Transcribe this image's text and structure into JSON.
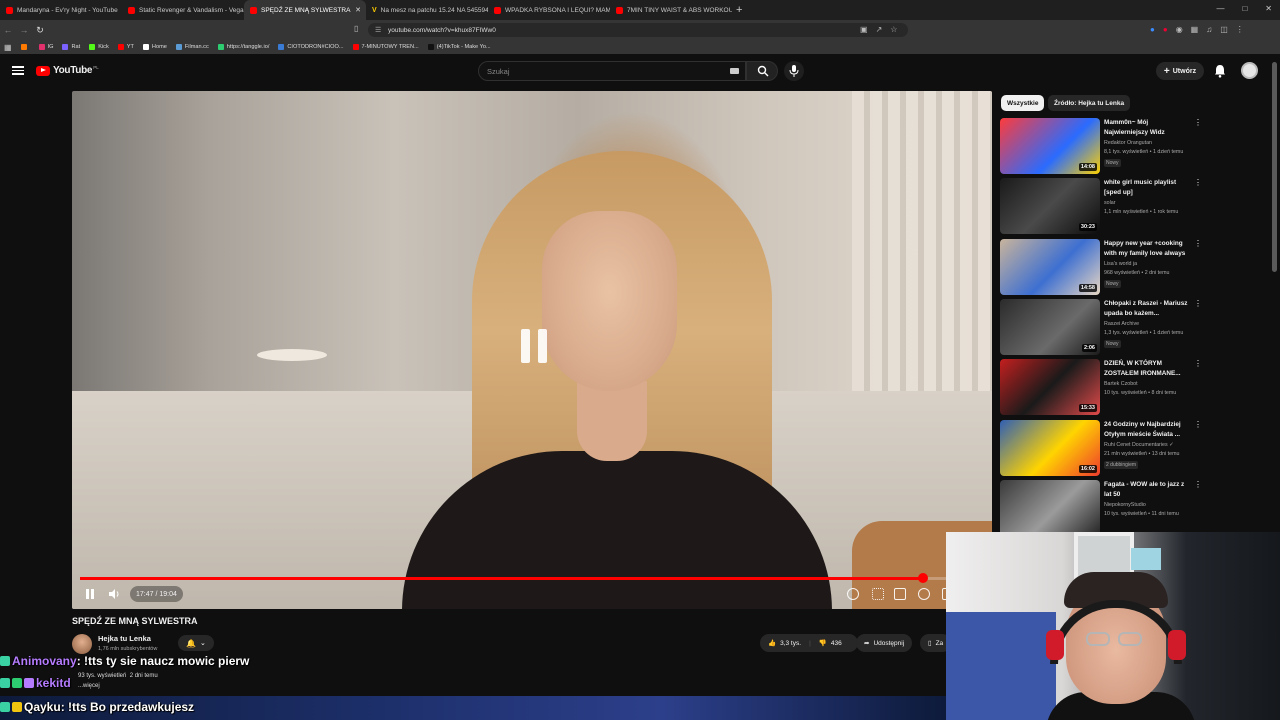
{
  "browser": {
    "tabs": [
      {
        "label": "Mandaryna - Ev'ry Night - YouTube",
        "fav": "yt"
      },
      {
        "label": "Static Revenger & Vandalism - Vega...",
        "fav": "yt"
      },
      {
        "label": "SPĘDŹ ZE MNĄ SYLWESTRA",
        "fav": "yt",
        "active": true
      },
      {
        "label": "Na mesz na patchu 15.24 NA 545594",
        "fav": "v"
      },
      {
        "label": "WPADKA RYBSONA I LEQUI? MAMM...",
        "fav": "yt"
      },
      {
        "label": "7MIN TINY WAIST & ABS WORKOUT...",
        "fav": "yt"
      }
    ],
    "new_tab": "+",
    "url": "youtube.com/watch?v=khux87FIWw0",
    "bookmarks": [
      {
        "label": "",
        "color": "#ff7a00"
      },
      {
        "label": "IG",
        "color": "#e1306c"
      },
      {
        "label": "Rat",
        "color": "#7b61ff"
      },
      {
        "label": "Kick",
        "color": "#53fc18"
      },
      {
        "label": "YT",
        "color": "#ff0000"
      },
      {
        "label": "Home",
        "color": "#ffffff"
      },
      {
        "label": "Filman.cc",
        "color": "#5a9bd5"
      },
      {
        "label": "https://tanggle.io/",
        "color": "#2ecc71"
      },
      {
        "label": "CIOTODRON#CIOO...",
        "color": "#3a7bd5"
      },
      {
        "label": "7-MINUTOWY TREN...",
        "color": "#ff0000"
      },
      {
        "label": "(4)TikTok - Make Yo...",
        "color": "#111111"
      }
    ]
  },
  "masthead": {
    "logo_text": "YouTube",
    "country_code": "PL",
    "search_placeholder": "Szukaj",
    "create_label": "Utwórz"
  },
  "player": {
    "time": "17:47 / 19:04",
    "progress": 0.932
  },
  "video": {
    "title": "SPĘDŹ ZE MNĄ SYLWESTRA",
    "channel": "Hejka tu Lenka",
    "subscribers": "1,76 mln subskrybentów",
    "likes": "3,3 tys.",
    "dislikes": "436",
    "share_label": "Udostępnij",
    "save_label": "Za",
    "views": "93 tys. wyświetleń",
    "posted": "2 dni temu",
    "more_label": "...więcej"
  },
  "chat": [
    {
      "user": "Animovany",
      "user_color": "#b57cff",
      "text": ": !tts ty sie naucz mowic pierw"
    },
    {
      "user": "kekitd",
      "user_color": "#b57cff",
      "text": ""
    },
    {
      "user": "Qayku",
      "user_color": "#ffffff",
      "text": ": !tts Bo przedawkujesz"
    }
  ],
  "sidebar": {
    "chips": [
      "Wszystkie",
      "Źródło: Hejka tu Lenka"
    ],
    "items": [
      {
        "title": "Mamm0n~ Mój Najwierniejszy Widz",
        "channel": "Redaktor Orangutan",
        "meta": "8,1 tys. wyświetleń • 1 dzień temu",
        "badge": "Nowy",
        "duration": "14:08",
        "thumb": "linear-gradient(135deg,#ff3b3b,#2a6bff 60%,#ffd200)"
      },
      {
        "title": "white girl music playlist [sped up]",
        "channel": "solar",
        "meta": "1,1 mln wyświetleń • 1 rok temu",
        "badge": "",
        "duration": "30:23",
        "thumb": "linear-gradient(135deg,#1a1a1a,#4a4a4a 50%,#0c0c0c)"
      },
      {
        "title": "Happy new year +cooking with my family love always",
        "channel": "Lisa's world ja",
        "meta": "968 wyświetleń • 2 dni temu",
        "badge": "Nowy",
        "duration": "14:58",
        "thumb": "linear-gradient(135deg,#c9b49c,#3d6fd1 55%,#e8d7c3)"
      },
      {
        "title": "Chłopaki z Raszei - Mariusz upada bo każem...",
        "channel": "Raszei Archive",
        "meta": "1,3 tys. wyświetleń • 1 dzień temu",
        "badge": "Nowy",
        "duration": "2:06",
        "thumb": "linear-gradient(135deg,#2b2b2b,#6a6a6a 60%,#1b1b1b)"
      },
      {
        "title": "DZIEŃ, W KTÓRYM ZOSTAŁEM IRONMANE...",
        "channel": "Bartek Czobot",
        "meta": "10 tys. wyświetleń • 8 dni temu",
        "badge": "",
        "duration": "15:33",
        "thumb": "linear-gradient(135deg,#c41f1f,#1a1a1a 50%,#e24a4a)"
      },
      {
        "title": "24 Godziny w Najbardziej Otyłym mieście Świata ...",
        "channel": "Ruhi Cenet Documentaries ✓",
        "meta": "21 mln wyświetleń • 13 dni temu",
        "badge": "2 dubbingiem",
        "duration": "16:02",
        "thumb": "linear-gradient(135deg,#2f5fb5,#ffd400 55%,#ef3b2c)"
      },
      {
        "title": "Fagata - WOW ale to jazz z lat 50",
        "channel": "NiepokornyStudio",
        "meta": "10 tys. wyświetleń • 11 dni temu",
        "badge": "",
        "duration": "",
        "thumb": "linear-gradient(135deg,#3a3a3a,#9b9b9b 55%,#222)"
      }
    ]
  }
}
